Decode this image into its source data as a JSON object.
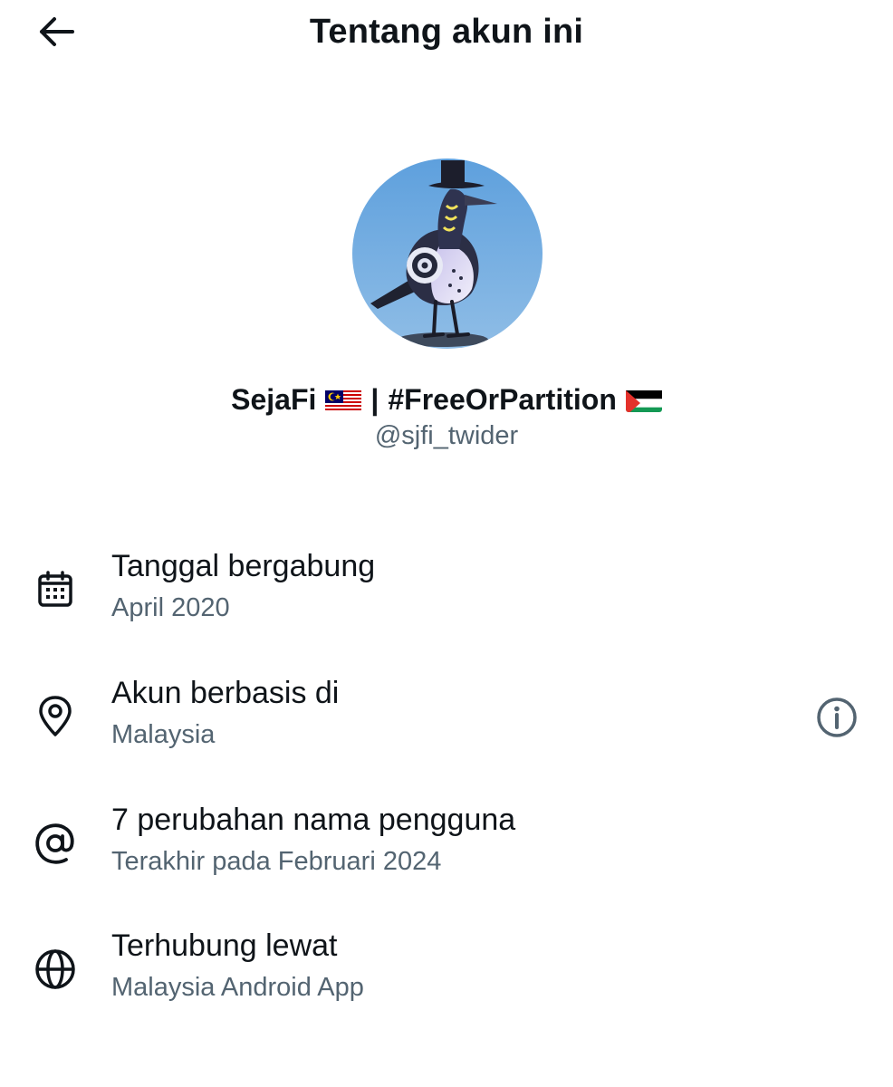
{
  "header": {
    "title": "Tentang akun ini",
    "back_icon": "arrow-left-icon"
  },
  "profile": {
    "display_name_part1": "SejaFi",
    "separator": "|",
    "display_name_part2": "#FreeOrPartition",
    "flag1_icon": "malaysia-flag-icon",
    "flag2_icon": "palestine-flag-icon",
    "handle": "@sjfi_twider",
    "avatar_icon": "avatar-bird-image"
  },
  "rows": [
    {
      "title": "Tanggal bergabung",
      "sub": "April 2020",
      "icon": "calendar-icon"
    },
    {
      "title": "Akun berbasis di",
      "sub": "Malaysia",
      "icon": "location-pin-icon",
      "action_icon": "info-icon"
    },
    {
      "title": "7 perubahan nama pengguna",
      "sub": "Terakhir pada Februari 2024",
      "icon": "at-sign-icon"
    },
    {
      "title": "Terhubung lewat",
      "sub": "Malaysia Android App",
      "icon": "globe-icon"
    }
  ],
  "colors": {
    "text_primary": "#0f1419",
    "text_secondary": "#536471",
    "background": "#ffffff",
    "avatar_sky": "#6fa8dc"
  }
}
